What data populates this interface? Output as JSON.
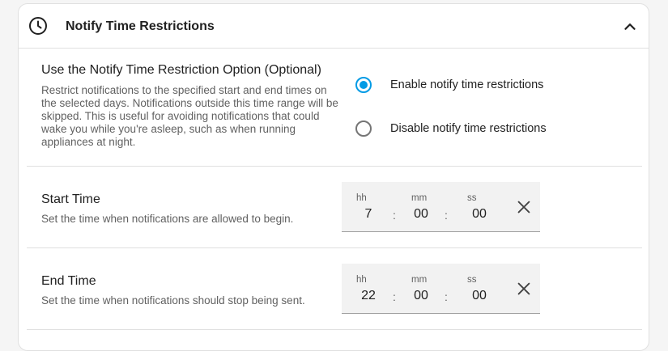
{
  "header": {
    "title": "Notify Time Restrictions",
    "clock_icon": "clock-icon",
    "collapse_icon": "chevron-up-icon"
  },
  "option": {
    "title": "Use the Notify Time Restriction Option (Optional)",
    "description": "Restrict notifications to the specified start and end times on the selected days. Notifications outside this time range will be skipped. This is useful for avoiding notifications that could wake you while you're asleep, such as when running appliances at night.",
    "radios": [
      {
        "label": "Enable notify time restrictions",
        "checked": true
      },
      {
        "label": "Disable notify time restrictions",
        "checked": false
      }
    ]
  },
  "start_time": {
    "title": "Start Time",
    "description": "Set the time when notifications are allowed to begin.",
    "hh_label": "hh",
    "mm_label": "mm",
    "ss_label": "ss",
    "hh": "7",
    "mm": "00",
    "ss": "00",
    "separator": ":"
  },
  "end_time": {
    "title": "End Time",
    "description": "Set the time when notifications should stop being sent.",
    "hh_label": "hh",
    "mm_label": "mm",
    "ss_label": "ss",
    "hh": "22",
    "mm": "00",
    "ss": "00",
    "separator": ":"
  },
  "colors": {
    "accent": "#039be5",
    "text_primary": "#212121",
    "text_secondary": "#616161",
    "field_bg": "#f2f2f2"
  }
}
